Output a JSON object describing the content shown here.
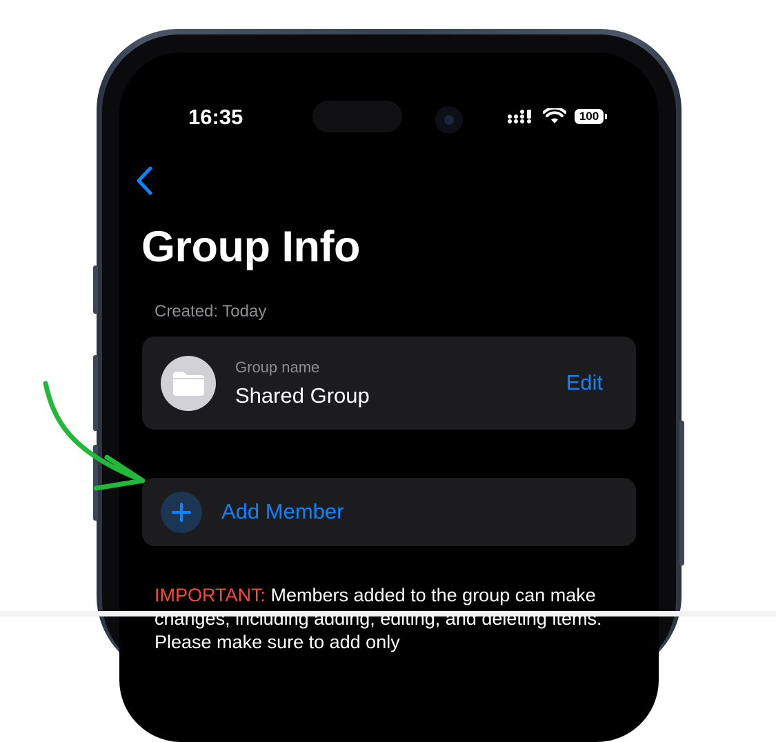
{
  "status_bar": {
    "time": "16:35",
    "battery": "100"
  },
  "nav": {
    "back_icon": "chevron-left-icon"
  },
  "page": {
    "title": "Group Info",
    "created": "Created: Today"
  },
  "group_card": {
    "avatar_icon": "folder-icon",
    "name_label": "Group name",
    "name_value": "Shared Group",
    "edit_label": "Edit"
  },
  "add_member": {
    "icon": "plus-icon",
    "label": "Add Member"
  },
  "notice": {
    "prefix": "IMPORTANT:",
    "text": " Members added to the group can make changes, including adding, editing, and deleting items. Please make sure to add only"
  },
  "colors": {
    "accent": "#0a84ff",
    "important": "#ff453a",
    "annotation_arrow": "#22b83a"
  }
}
